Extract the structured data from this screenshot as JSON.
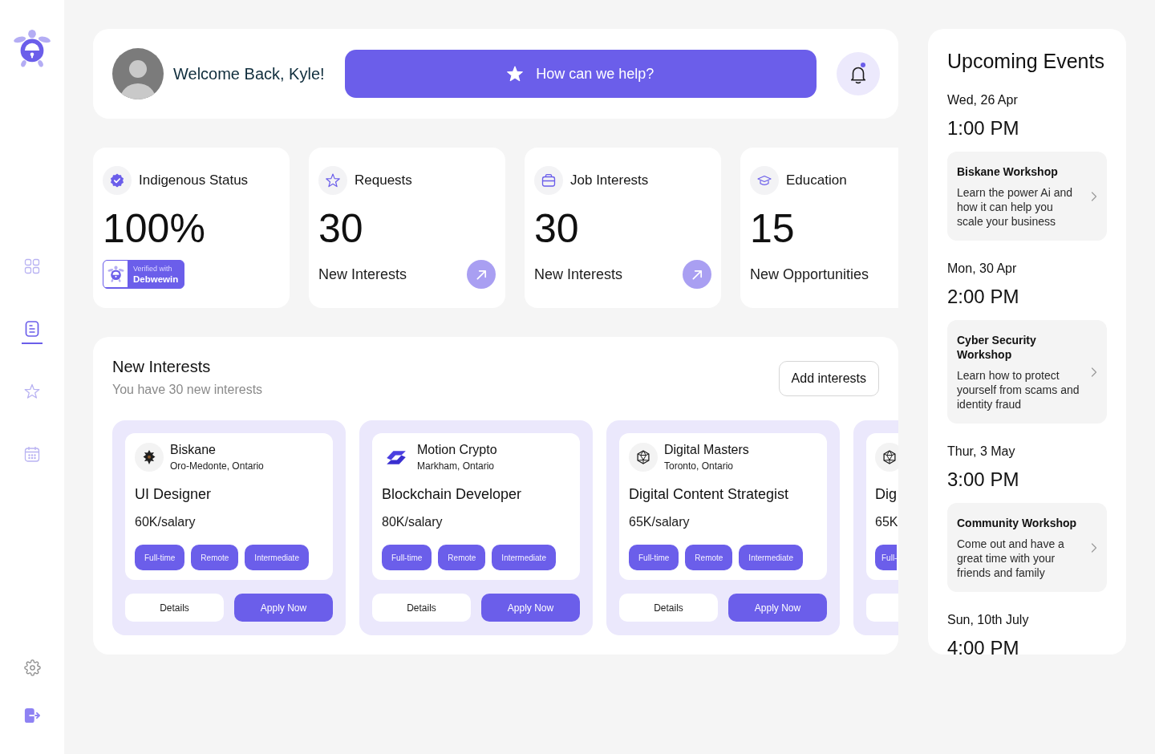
{
  "sidebar": {
    "nav_items": [
      {
        "selected": false
      },
      {
        "selected": true
      },
      {
        "selected": false
      },
      {
        "selected": false
      }
    ]
  },
  "header": {
    "greeting": "Welcome Back, Kyle!",
    "help_button": "How can we help?",
    "unread_notifications": true
  },
  "stats": [
    {
      "kind": "badge",
      "title": "Indigenous Status",
      "value": "100%",
      "badge": {
        "caption": "Verified with",
        "name": "Debwewin"
      }
    },
    {
      "kind": "link",
      "title": "Requests",
      "value": "30",
      "caption": "New Interests"
    },
    {
      "kind": "link",
      "title": "Job Interests",
      "value": "30",
      "caption": "New Interests"
    },
    {
      "kind": "plain",
      "title": "Education",
      "value": "15",
      "caption": "New Opportunities"
    }
  ],
  "interests": {
    "title": "New Interests",
    "subtitle": "You have 30 new interests",
    "add_button": "Add interests",
    "jobs": [
      {
        "kind": "card",
        "company": "Biskane",
        "location": "Oro-Medonte, Ontario",
        "title": "UI Designer",
        "salary": "60K/salary",
        "tags": [
          "Full-time",
          "Remote",
          "Intermediate"
        ],
        "details_button": "Details",
        "apply_button": "Apply Now"
      },
      {
        "kind": "card",
        "company": "Motion Crypto",
        "location": "Markham, Ontario",
        "title": "Blockchain Developer",
        "salary": "80K/salary",
        "tags": [
          "Full-time",
          "Remote",
          "Intermediate"
        ],
        "details_button": "Details",
        "apply_button": "Apply Now"
      },
      {
        "kind": "card",
        "company": "Digital Masters",
        "location": "Toronto, Ontario",
        "title": "Digital Content Strategist",
        "salary": "65K/salary",
        "tags": [
          "Full-time",
          "Remote",
          "Intermediate"
        ],
        "details_button": "Details",
        "apply_button": "Apply Now"
      },
      {
        "kind": "peek",
        "title": "Dig",
        "salary": "65K",
        "tags": [
          "Full-"
        ]
      }
    ]
  },
  "events": {
    "title": "Upcoming Events",
    "items": [
      {
        "date": "Wed, 26 Apr",
        "time": "1:00 PM",
        "title": "Biskane Workshop",
        "description": "Learn the power Ai and how it can help you scale your business"
      },
      {
        "date": "Mon, 30 Apr",
        "time": "2:00 PM",
        "title": "Cyber Security Workshop",
        "description": "Learn how to protect yourself from scams and identity fraud"
      },
      {
        "date": "Thur, 3 May",
        "time": "3:00 PM",
        "title": "Community Workshop",
        "description": "Come out and have a great time with your friends and family"
      },
      {
        "date": "Sun, 10th July",
        "time": "4:00 PM"
      }
    ]
  }
}
